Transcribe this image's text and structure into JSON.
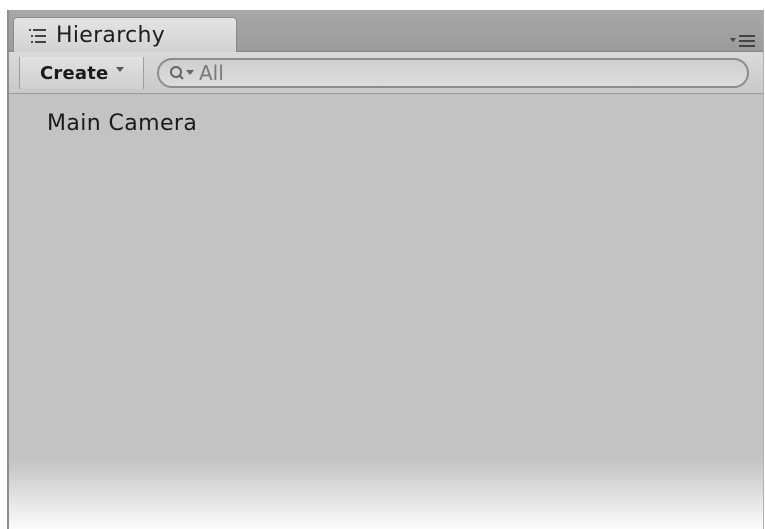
{
  "panel": {
    "tab_title": "Hierarchy",
    "tab_icon": "hierarchy-list-icon",
    "menu_icon": "panel-menu-icon"
  },
  "toolbar": {
    "create_label": "Create",
    "create_dropdown_icon": "dropdown-arrow-icon",
    "search": {
      "icon": "search-dropdown-icon",
      "placeholder": "All",
      "value": ""
    }
  },
  "hierarchy": {
    "items": [
      {
        "label": "Main Camera"
      }
    ]
  },
  "colors": {
    "panel_background": "#c3c3c3",
    "tab_background": "#dcdcdc",
    "text": "#1a1a1a",
    "placeholder": "#7a7a7a"
  }
}
